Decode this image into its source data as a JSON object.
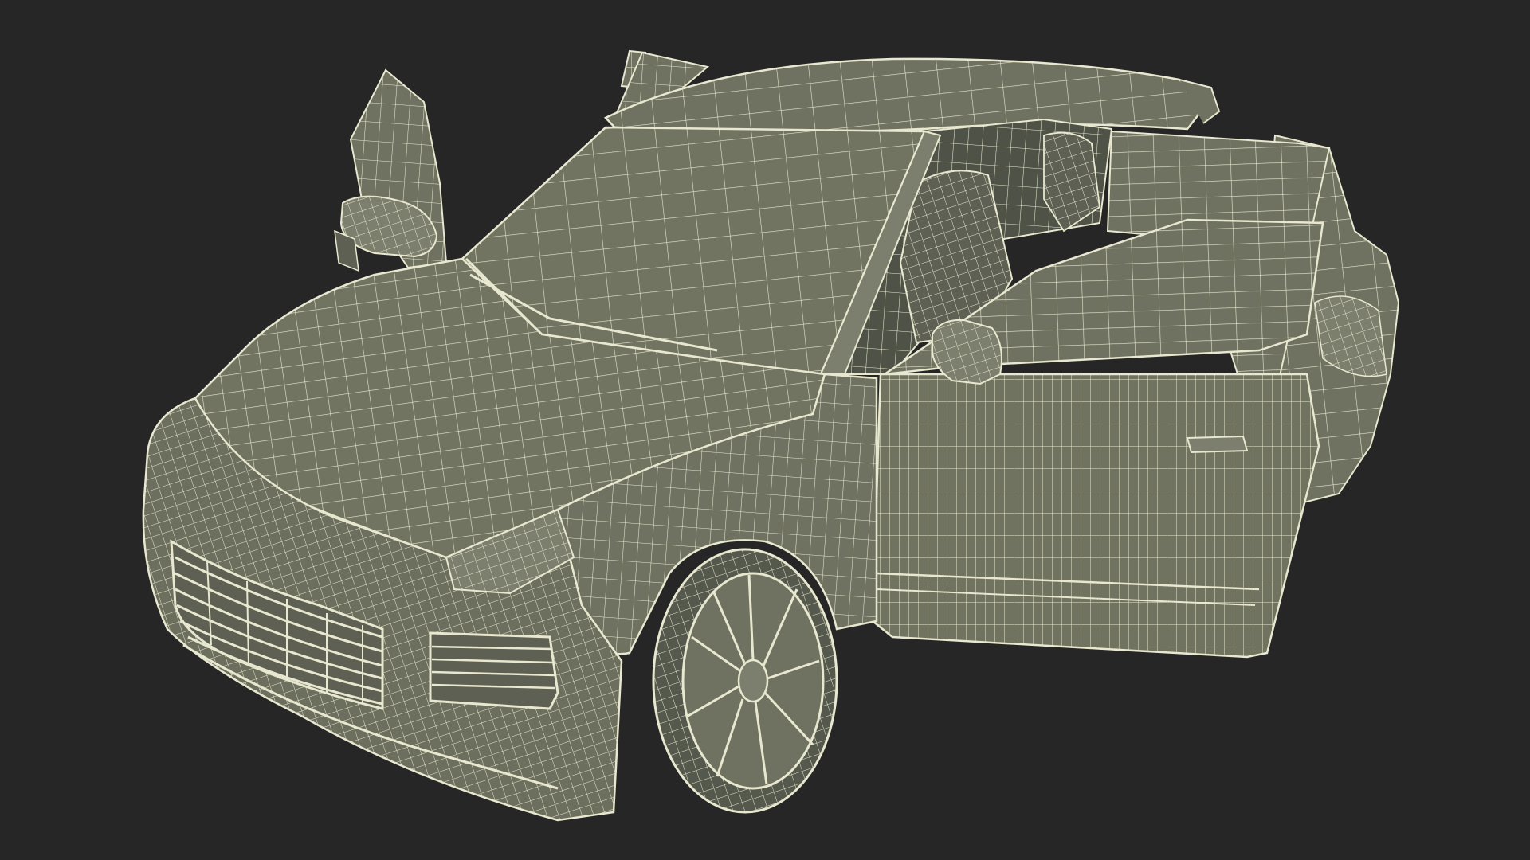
{
  "scene": {
    "subject_icon": "wireframe-suv-icon",
    "colors": {
      "background": "#262626",
      "surface": "#6f7261",
      "surface_light": "#7c7f6d",
      "surface_dark": "#5d6052",
      "wire": "#e8e7cf",
      "interior": "#4f5247",
      "tire": "#55584c"
    }
  }
}
